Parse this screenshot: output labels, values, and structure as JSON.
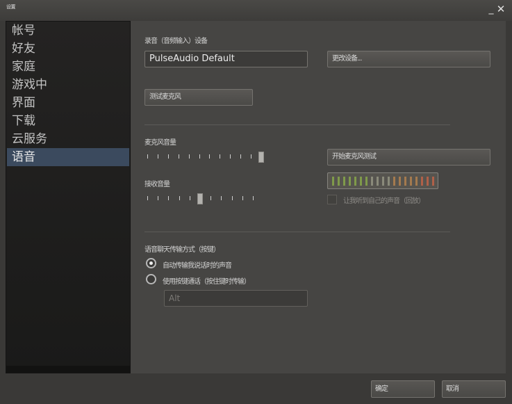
{
  "window": {
    "title": "设置",
    "minimize_glyph": "_",
    "close_glyph": "✕"
  },
  "sidebar": {
    "items": [
      {
        "label": "帐号"
      },
      {
        "label": "好友"
      },
      {
        "label": "家庭"
      },
      {
        "label": "游戏中"
      },
      {
        "label": "界面"
      },
      {
        "label": "下载"
      },
      {
        "label": "云服务"
      },
      {
        "label": "语音"
      }
    ],
    "active_index": 7
  },
  "voice": {
    "device_heading": "录音（音频输入）设备",
    "input_device_value": "PulseAudio Default",
    "change_device_label": "更改设备...",
    "test_device_label": "测试麦克风",
    "volume_heading": "麦克风音量",
    "test_mic_label": "开始麦克风测试",
    "output_heading": "接收音量",
    "output_level": 0.5,
    "input_level": 1.0,
    "meter_colors": [
      "#7f9a4a",
      "#7f9a4a",
      "#7f9a4a",
      "#7f9a4a",
      "#7f9a4a",
      "#7f9a4a",
      "#7f9a4a",
      "#8a8a7a",
      "#8a8a7a",
      "#8a8a7a",
      "#8a8a7a",
      "#a47a4e",
      "#a47a4e",
      "#a47a4e",
      "#a47a4e",
      "#a47a4e",
      "#b06048",
      "#b06048",
      "#b06048"
    ],
    "loopback_label": "让我听到自己的声音（回放）",
    "transmit_heading": "语音聊天传输方式（按键）",
    "open_mic_label": "自动传输我说话时的声音",
    "push_to_talk_label": "使用按键通话（按住键时传输）",
    "push_to_talk_key": "Alt"
  },
  "footer": {
    "ok_label": "确定",
    "cancel_label": "取消"
  }
}
